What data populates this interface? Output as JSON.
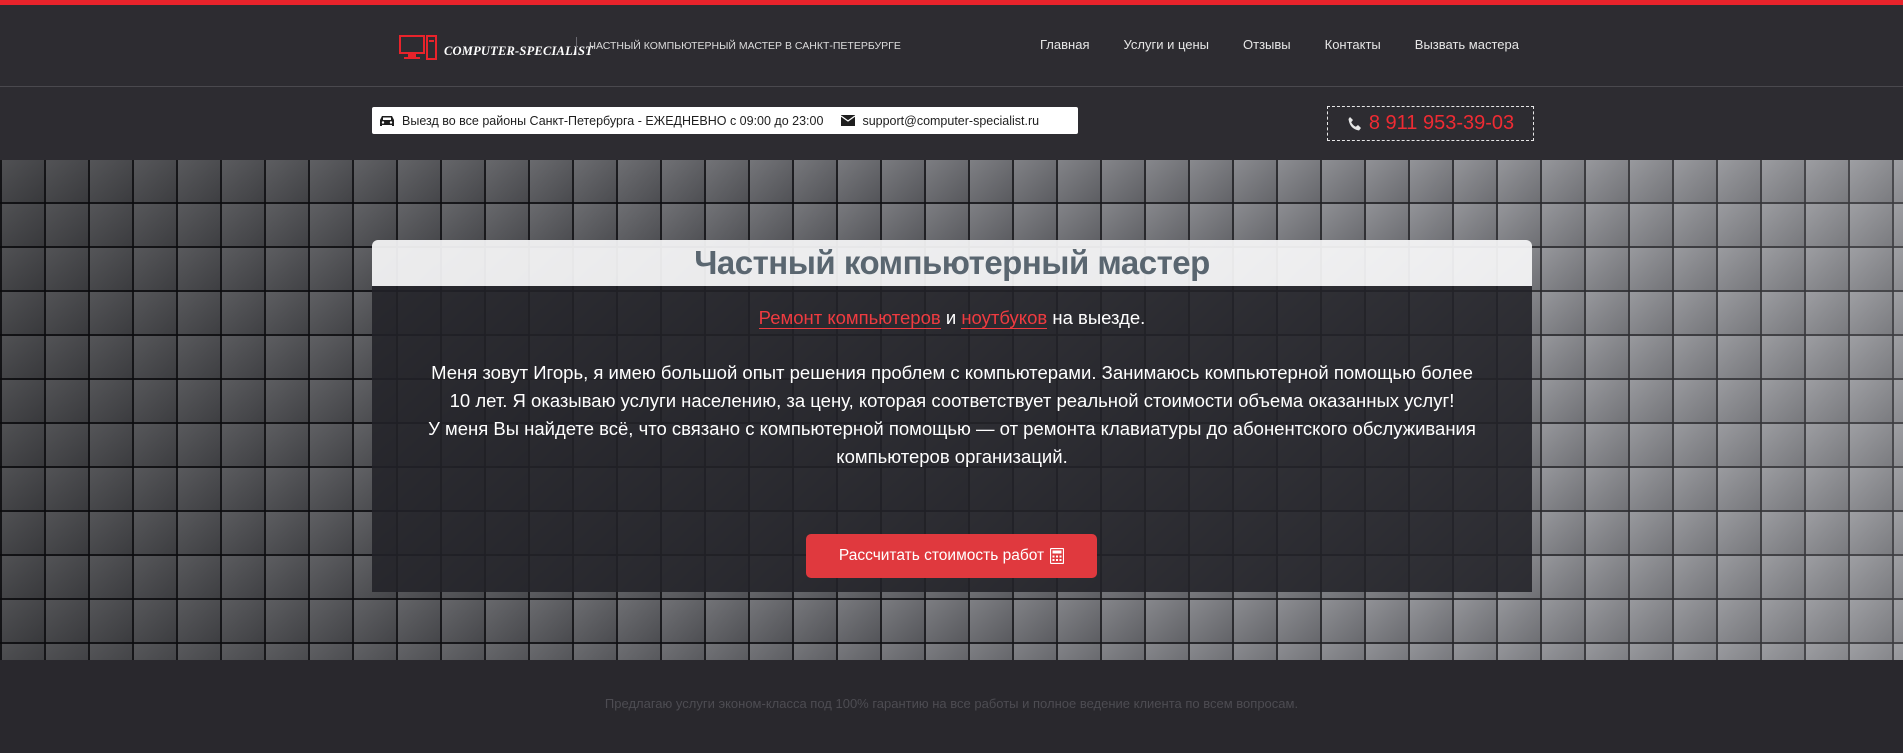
{
  "brand": {
    "logo_text": "COMPUTER-SPECIALIST",
    "tagline": "ЧАСТНЫЙ КОМПЬЮТЕРНЫЙ МАСТЕР В САНКТ-ПЕТЕРБУРГЕ"
  },
  "nav": {
    "items": [
      "Главная",
      "Услуги и цены",
      "Отзывы",
      "Контакты",
      "Вызвать мастера"
    ]
  },
  "info": {
    "schedule_icon": "car-icon",
    "schedule": "Выезд во все районы Санкт-Петербурга - ЕЖЕДНЕВНО с 09:00 до 23:00",
    "email_icon": "envelope-icon",
    "email": "support@computer-specialist.ru",
    "phone_icon": "phone-icon",
    "phone": "8 911 953-39-03"
  },
  "hero": {
    "title": "Частный компьютерный мастер",
    "sub_link1": "Ремонт компьютеров",
    "sub_and": "и",
    "sub_link2": "ноутбуков",
    "sub_rest": "на выезде.",
    "paragraph1": "Меня зовут Игорь, я имею большой опыт решения проблем с компьютерами. Занимаюсь компьютерной помощью более 10 лет. Я оказываю услуги населению, за цену, которая соответствует реальной стоимости объема оказанных услуг!",
    "paragraph2": "У меня Вы найдете всё, что связано с компьютерной помощью — от ремонта клавиатуры до абонентского обслуживания компьютеров организаций.",
    "cta_label": "Рассчитать стоимость работ",
    "cta_icon": "calculator-icon"
  },
  "footer": {
    "text": "Предлагаю услуги эконом-класса под 100% гарантию на все работы и полное ведение клиента по всем вопросам."
  },
  "colors": {
    "accent": "#e8232b",
    "header_bg": "#2d2c31",
    "title": "#5a6670",
    "cta": "#e0393e"
  }
}
